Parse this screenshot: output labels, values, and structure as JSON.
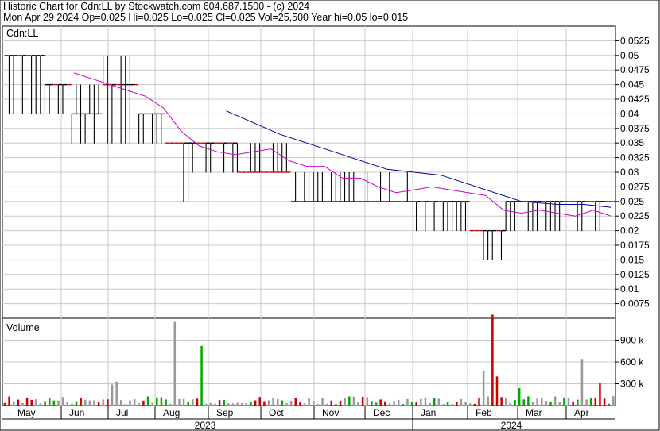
{
  "header": {
    "line1": "Historic Chart for Cdn:LL by Stockwatch.com 604.687.1500 - (c) 2024",
    "line2": "Mon Apr 29 2024   Op=0.025  Hi=0.025  Lo=0.025  Cl=0.025  Vol=25,500  Year hi=0.05  lo=0.015"
  },
  "colors": {
    "price_bar": "#000000",
    "close_tick_down": "#cc0000",
    "ma_short": "#cc00cc",
    "ma_long": "#000099",
    "vol_up": "#00aa00",
    "vol_down": "#cc0000",
    "vol_flat": "#999999",
    "grid": "#c8c8c8"
  },
  "chart_data": [
    {
      "type": "ohlc",
      "title": "Cdn:LL",
      "ylim": [
        0.005,
        0.055
      ],
      "yticks": [
        "0.0525",
        "0.05",
        "0.0475",
        "0.045",
        "0.0425",
        "0.04",
        "0.0375",
        "0.035",
        "0.0325",
        "0.03",
        "0.0275",
        "0.025",
        "0.0225",
        "0.02",
        "0.0175",
        "0.015",
        "0.0125",
        "0.01",
        "0.0075"
      ],
      "x_months": [
        "May",
        "Jun",
        "Jul",
        "Aug",
        "Sep",
        "Oct",
        "Nov",
        "Dec",
        "Jan",
        "Feb",
        "Mar",
        "Apr"
      ],
      "x_years": [
        "2023",
        "2024"
      ],
      "segments": [
        {
          "from": 0,
          "to": 9,
          "lo": 0.04,
          "hi": 0.05,
          "cl": 0.05
        },
        {
          "from": 9,
          "to": 15,
          "lo": 0.04,
          "hi": 0.045,
          "cl": 0.045
        },
        {
          "from": 15,
          "to": 22,
          "lo": 0.035,
          "hi": 0.045,
          "cl": 0.04
        },
        {
          "from": 22,
          "to": 30,
          "lo": 0.035,
          "hi": 0.05,
          "cl": 0.045
        },
        {
          "from": 30,
          "to": 36,
          "lo": 0.035,
          "hi": 0.04,
          "cl": 0.04
        },
        {
          "from": 36,
          "to": 42,
          "lo": 0.025,
          "hi": 0.035,
          "cl": 0.035
        },
        {
          "from": 42,
          "to": 52,
          "lo": 0.03,
          "hi": 0.035,
          "cl": 0.035
        },
        {
          "from": 52,
          "to": 64,
          "lo": 0.03,
          "hi": 0.035,
          "cl": 0.03
        },
        {
          "from": 64,
          "to": 80,
          "lo": 0.025,
          "hi": 0.03,
          "cl": 0.025
        },
        {
          "from": 80,
          "to": 92,
          "lo": 0.025,
          "hi": 0.03,
          "cl": 0.025
        },
        {
          "from": 92,
          "to": 104,
          "lo": 0.02,
          "hi": 0.025,
          "cl": 0.025
        },
        {
          "from": 104,
          "to": 112,
          "lo": 0.015,
          "hi": 0.02,
          "cl": 0.02
        },
        {
          "from": 112,
          "to": 126,
          "lo": 0.02,
          "hi": 0.025,
          "cl": 0.025
        },
        {
          "from": 126,
          "to": 137,
          "lo": 0.02,
          "hi": 0.025,
          "cl": 0.025
        }
      ],
      "ma_short": [
        [
          16,
          0.047
        ],
        [
          20,
          0.046
        ],
        [
          24,
          0.045
        ],
        [
          28,
          0.044
        ],
        [
          32,
          0.043
        ],
        [
          36,
          0.041
        ],
        [
          40,
          0.037
        ],
        [
          44,
          0.0345
        ],
        [
          48,
          0.0335
        ],
        [
          52,
          0.033
        ],
        [
          56,
          0.0335
        ],
        [
          60,
          0.034
        ],
        [
          64,
          0.032
        ],
        [
          68,
          0.031
        ],
        [
          72,
          0.031
        ],
        [
          76,
          0.029
        ],
        [
          80,
          0.029
        ],
        [
          84,
          0.0275
        ],
        [
          88,
          0.0265
        ],
        [
          92,
          0.027
        ],
        [
          96,
          0.0275
        ],
        [
          100,
          0.027
        ],
        [
          104,
          0.0265
        ],
        [
          108,
          0.026
        ],
        [
          112,
          0.0235
        ],
        [
          116,
          0.023
        ],
        [
          120,
          0.0235
        ],
        [
          124,
          0.023
        ],
        [
          128,
          0.0225
        ],
        [
          132,
          0.0235
        ],
        [
          136,
          0.0225
        ]
      ],
      "ma_long": [
        [
          50,
          0.0405
        ],
        [
          56,
          0.0385
        ],
        [
          62,
          0.0365
        ],
        [
          68,
          0.035
        ],
        [
          74,
          0.0335
        ],
        [
          80,
          0.032
        ],
        [
          86,
          0.0305
        ],
        [
          92,
          0.03
        ],
        [
          98,
          0.0295
        ],
        [
          104,
          0.028
        ],
        [
          110,
          0.0265
        ],
        [
          116,
          0.025
        ],
        [
          124,
          0.0245
        ],
        [
          130,
          0.0245
        ],
        [
          136,
          0.024
        ]
      ]
    },
    {
      "type": "bar",
      "title": "Volume",
      "ylim": [
        0,
        1200000
      ],
      "yticks": [
        "900 k",
        "600 k",
        "300 k"
      ],
      "highlights": [
        {
          "i": 38,
          "v": 1150000,
          "c": "vol_flat"
        },
        {
          "i": 44,
          "v": 820000,
          "c": "vol_up"
        },
        {
          "i": 109,
          "v": 1250000,
          "c": "vol_down"
        },
        {
          "i": 107,
          "v": 480000,
          "c": "vol_flat"
        },
        {
          "i": 110,
          "v": 400000,
          "c": "vol_down"
        },
        {
          "i": 129,
          "v": 640000,
          "c": "vol_flat"
        },
        {
          "i": 133,
          "v": 310000,
          "c": "vol_down"
        },
        {
          "i": 115,
          "v": 240000,
          "c": "vol_up"
        },
        {
          "i": 25,
          "v": 330000,
          "c": "vol_flat"
        },
        {
          "i": 24,
          "v": 290000,
          "c": "vol_flat"
        }
      ]
    }
  ]
}
